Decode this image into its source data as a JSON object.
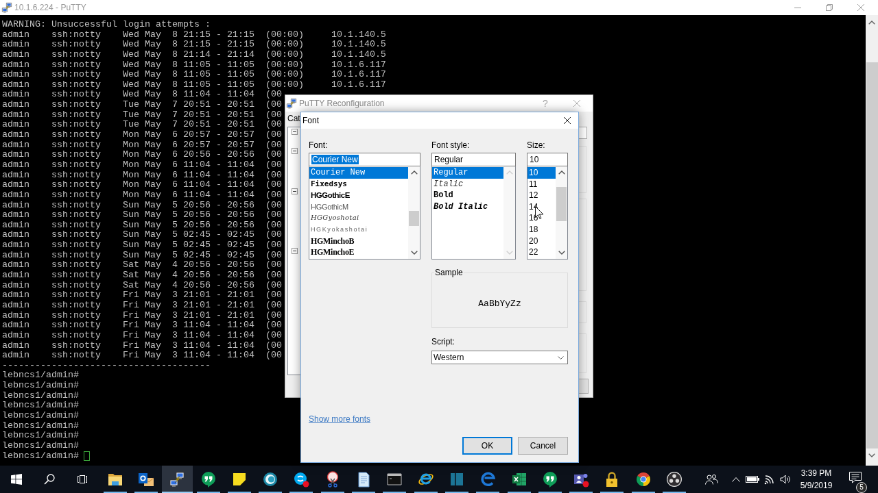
{
  "putty_window": {
    "title": "10.1.6.224 - PuTTY"
  },
  "terminal": {
    "lines": [
      "WARNING: Unsuccessful login attempts :",
      "admin    ssh:notty    Wed May  8 21:15 - 21:15  (00:00)     10.1.140.5",
      "admin    ssh:notty    Wed May  8 21:15 - 21:15  (00:00)     10.1.140.5",
      "admin    ssh:notty    Wed May  8 21:14 - 21:14  (00:00)     10.1.140.5",
      "admin    ssh:notty    Wed May  8 11:05 - 11:05  (00:00)     10.1.6.117",
      "admin    ssh:notty    Wed May  8 11:05 - 11:05  (00:00)     10.1.6.117",
      "admin    ssh:notty    Wed May  8 11:05 - 11:05  (00:00)     10.1.6.117",
      "admin    ssh:notty    Wed May  8 11:04 - 11:04  (00",
      "admin    ssh:notty    Tue May  7 20:51 - 20:51  (00",
      "admin    ssh:notty    Tue May  7 20:51 - 20:51  (00",
      "admin    ssh:notty    Tue May  7 20:51 - 20:51  (00",
      "admin    ssh:notty    Mon May  6 20:57 - 20:57  (00",
      "admin    ssh:notty    Mon May  6 20:57 - 20:57  (00",
      "admin    ssh:notty    Mon May  6 20:56 - 20:56  (00",
      "admin    ssh:notty    Mon May  6 11:04 - 11:04  (00",
      "admin    ssh:notty    Mon May  6 11:04 - 11:04  (00",
      "admin    ssh:notty    Mon May  6 11:04 - 11:04  (00",
      "admin    ssh:notty    Mon May  6 11:04 - 11:04  (00",
      "admin    ssh:notty    Sun May  5 20:56 - 20:56  (00",
      "admin    ssh:notty    Sun May  5 20:56 - 20:56  (00",
      "admin    ssh:notty    Sun May  5 20:56 - 20:56  (00",
      "admin    ssh:notty    Sun May  5 02:45 - 02:45  (00",
      "admin    ssh:notty    Sun May  5 02:45 - 02:45  (00",
      "admin    ssh:notty    Sun May  5 02:45 - 02:45  (00",
      "admin    ssh:notty    Sat May  4 20:56 - 20:56  (00",
      "admin    ssh:notty    Sat May  4 20:56 - 20:56  (00",
      "admin    ssh:notty    Sat May  4 20:56 - 20:56  (00",
      "admin    ssh:notty    Fri May  3 21:01 - 21:01  (00",
      "admin    ssh:notty    Fri May  3 21:01 - 21:01  (00",
      "admin    ssh:notty    Fri May  3 21:01 - 21:01  (00",
      "admin    ssh:notty    Fri May  3 11:04 - 11:04  (00",
      "admin    ssh:notty    Fri May  3 11:04 - 11:04  (00",
      "admin    ssh:notty    Fri May  3 11:04 - 11:04  (00",
      "admin    ssh:notty    Fri May  3 11:04 - 11:04  (00",
      "--------------------------------------",
      "lebncs1/admin#",
      "lebncs1/admin#",
      "lebncs1/admin#",
      "lebncs1/admin#",
      "lebncs1/admin#",
      "lebncs1/admin#",
      "lebncs1/admin#",
      "lebncs1/admin#",
      "lebncs1/admin#"
    ]
  },
  "reconfig_window": {
    "title": "PuTTY Reconfiguration",
    "help": "?",
    "category_label": "Cat"
  },
  "font_dialog": {
    "title": "Font",
    "font": {
      "label": "Font:",
      "value": "Courier New",
      "text_selected": true,
      "items": [
        {
          "name": "Courier New",
          "selected": true
        },
        {
          "name": "Fixedsys",
          "selected": false
        },
        {
          "name": "HGGothicE",
          "selected": false
        },
        {
          "name": "HGGothicM",
          "selected": false
        },
        {
          "name": "HGGyoshotai",
          "selected": false
        },
        {
          "name": "HGKyokashotai",
          "selected": false
        },
        {
          "name": "HGMinchoB",
          "selected": false
        },
        {
          "name": "HGMinchoE",
          "selected": false
        }
      ]
    },
    "style": {
      "label": "Font style:",
      "value": "Regular",
      "items": [
        {
          "name": "Regular",
          "selected": true
        },
        {
          "name": "Italic",
          "selected": false
        },
        {
          "name": "Bold",
          "selected": false
        },
        {
          "name": "Bold Italic",
          "selected": false
        }
      ]
    },
    "size": {
      "label": "Size:",
      "value": "10",
      "items": [
        {
          "name": "10",
          "selected": true
        },
        {
          "name": "11",
          "selected": false
        },
        {
          "name": "12",
          "selected": false
        },
        {
          "name": "14",
          "selected": false
        },
        {
          "name": "16",
          "selected": false
        },
        {
          "name": "18",
          "selected": false
        },
        {
          "name": "20",
          "selected": false
        },
        {
          "name": "22",
          "selected": false
        }
      ]
    },
    "sample": {
      "label": "Sample",
      "text": "AaBbYyZz"
    },
    "script": {
      "label": "Script:",
      "value": "Western"
    },
    "more_fonts_link": "Show more fonts",
    "buttons": [
      {
        "label": "OK",
        "default": true
      },
      {
        "label": "Cancel",
        "default": false
      }
    ]
  },
  "taskbar": {
    "apps": [
      {
        "running": true,
        "active": false
      },
      {
        "running": true,
        "active": false
      },
      {
        "running": true,
        "active": true
      },
      {
        "running": true,
        "active": false
      },
      {
        "running": true,
        "active": false
      },
      {
        "running": true,
        "active": false
      },
      {
        "running": true,
        "active": false
      },
      {
        "running": true,
        "active": false
      },
      {
        "running": true,
        "active": false
      },
      {
        "running": true,
        "active": false
      },
      {
        "running": true,
        "active": false
      },
      {
        "running": true,
        "active": false
      },
      {
        "running": true,
        "active": false
      },
      {
        "running": true,
        "active": false
      },
      {
        "running": true,
        "active": false
      },
      {
        "running": true,
        "active": false
      },
      {
        "running": true,
        "active": false
      },
      {
        "running": true,
        "active": false
      },
      {
        "running": true,
        "active": false
      }
    ],
    "clock": {
      "time": "3:39 PM",
      "date": "5/9/2019"
    },
    "notification_count": "5"
  }
}
